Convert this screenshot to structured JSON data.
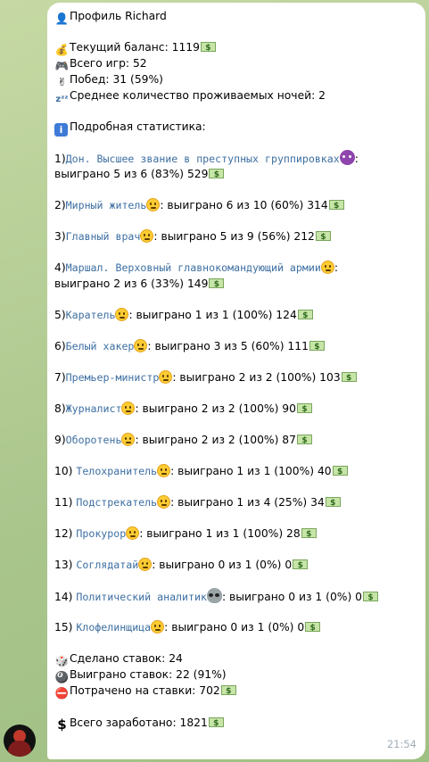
{
  "message": {
    "title": "Профиль Richard",
    "balance": "Текущий баланс: 1119",
    "games": "Всего игр: 52",
    "wins": "Побед: 31 (59%)",
    "nights": "Среднее количество проживаемых ночей: 2",
    "stats_header": "Подробная статистика:",
    "roles": [
      {
        "num": "1)",
        "name": "Дон. Высшее звание в преступных группировках",
        "sep": ":",
        "cont": "выиграно 5 из 6 (83%) 529"
      },
      {
        "num": "2)",
        "name": "Мирный житель",
        "text": ": выиграно 6 из 10 (60%) 314"
      },
      {
        "num": "3)",
        "name": "Главный врач",
        "text": ": выиграно 5 из 9 (56%) 212"
      },
      {
        "num": "4)",
        "name": "Маршал. Верховный главнокомандующий армии",
        "sep": ":",
        "cont": "выиграно 2 из 6 (33%) 149"
      },
      {
        "num": "5)",
        "name": "Каратель",
        "text": ": выиграно 1 из 1 (100%) 124"
      },
      {
        "num": "6)",
        "name": "Белый хакер",
        "text": ": выиграно 3 из 5 (60%) 111"
      },
      {
        "num": "7)",
        "name": "Премьер-министр",
        "text": ": выиграно 2 из 2 (100%) 103"
      },
      {
        "num": "8)",
        "name": "Журналист",
        "text": ": выиграно 2 из 2 (100%) 90"
      },
      {
        "num": "9)",
        "name": "Оборотень",
        "text": ": выиграно 2 из 2 (100%) 87"
      },
      {
        "num": "10)",
        "name": "Телохранитель",
        "text": ": выиграно 1 из 1 (100%) 40"
      },
      {
        "num": "11)",
        "name": "Подстрекатель",
        "text": ": выиграно 1 из 4 (25%) 34"
      },
      {
        "num": "12)",
        "name": "Прокурор",
        "text": ": выиграно 1 из 1 (100%) 28"
      },
      {
        "num": "13)",
        "name": "Соглядатай",
        "text": ": выиграно 0 из 1 (0%) 0"
      },
      {
        "num": "14)",
        "name": "Политический аналитик",
        "text": ": выиграно 0 из 1 (0%) 0"
      },
      {
        "num": "15)",
        "name": "Клофелинщица",
        "text": ": выиграно 0 из 1 (0%) 0"
      }
    ],
    "bets_made": "Сделано ставок: 24",
    "bets_won": "Выиграно ставок: 22 (91%)",
    "bets_spent": "Потрачено на ставки: 702",
    "total_earned": "Всего заработано: 1821",
    "time": "21:54"
  },
  "icons": {
    "title": "user-silhouette-icon",
    "balance": "money-bag-icon",
    "games": "gamepad-icon",
    "wins": "victory-hand-icon",
    "nights": "sleeping-zzz-icon",
    "stats": "info-icon",
    "bets_made": "dice-icon",
    "bets_won": "8-ball-icon",
    "bets_spent": "no-entry-icon",
    "total": "dollar-sign-icon"
  }
}
